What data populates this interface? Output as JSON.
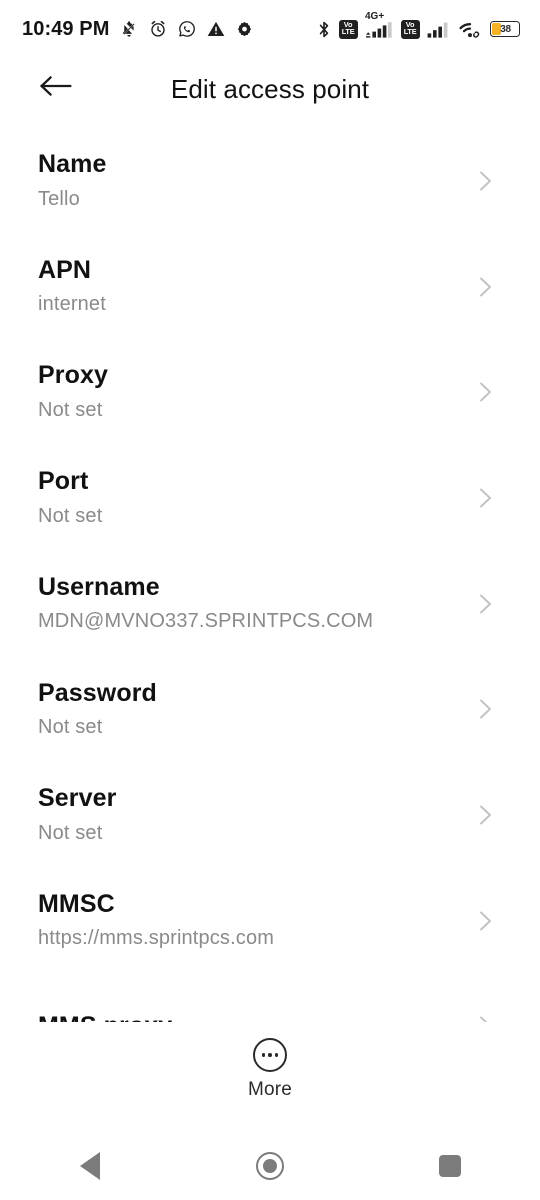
{
  "status_bar": {
    "time": "10:49 PM",
    "left_icons": [
      {
        "name": "notifications-off-icon",
        "label": "notifications-off"
      },
      {
        "name": "alarm-clock-icon",
        "label": "alarm"
      },
      {
        "name": "whatsapp-icon",
        "label": "whatsapp"
      },
      {
        "name": "warning-triangle-icon",
        "label": "warning"
      },
      {
        "name": "settings-gear-icon",
        "label": "settings"
      }
    ],
    "bluetooth": "bluetooth-icon",
    "sim1": {
      "volte_top": "Vo",
      "volte_bottom": "LTE",
      "network_label": "4G+",
      "signal_bars": 4
    },
    "sim2": {
      "volte_top": "Vo",
      "volte_bottom": "LTE",
      "signal_bars": 4
    },
    "wifi": "wifi-icon",
    "battery": {
      "percent": "38",
      "level": 38,
      "fill_color": "#f5b323"
    }
  },
  "app_bar": {
    "back_icon": "arrow-left-icon",
    "title": "Edit access point"
  },
  "list": {
    "rows": [
      {
        "title": "Name",
        "value": "Tello"
      },
      {
        "title": "APN",
        "value": "internet"
      },
      {
        "title": "Proxy",
        "value": "Not set"
      },
      {
        "title": "Port",
        "value": "Not set"
      },
      {
        "title": "Username",
        "value": "MDN@MVNO337.SPRINTPCS.COM"
      },
      {
        "title": "Password",
        "value": "Not set"
      },
      {
        "title": "Server",
        "value": "Not set"
      },
      {
        "title": "MMSC",
        "value": "https://mms.sprintpcs.com"
      },
      {
        "title": "MMS proxy",
        "value": ""
      }
    ]
  },
  "bottom_bar": {
    "more_label": "More",
    "more_icon": "more-dots-circle-icon"
  },
  "nav_bar": {
    "back": "nav-back-icon",
    "home": "nav-home-icon",
    "recents": "nav-recents-icon"
  },
  "colors": {
    "background": "#ffffff",
    "title_text": "#111111",
    "value_text": "#8a8a8a",
    "chevron": "#bdbdbd",
    "nav_icon": "#7c7c7c"
  }
}
